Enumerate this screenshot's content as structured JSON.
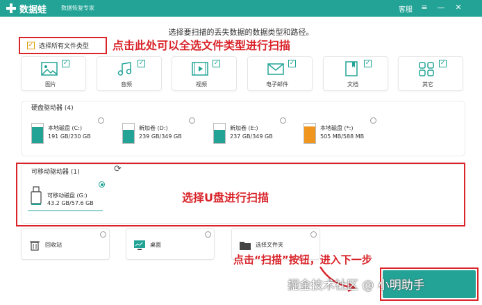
{
  "titlebar": {
    "app_name": "数据蛙",
    "app_subtitle": "数据恢复专家",
    "service": "客服",
    "menu_icon": "≡",
    "minimize_icon": "—",
    "close_icon": "✕"
  },
  "prompt": "选择要扫描的丢失数据的数据类型和路径。",
  "select_all": {
    "label": "选择所有文件类型",
    "checked": true
  },
  "annotations": {
    "select_all_hint": "点击此处可以全选文件类型进行扫描",
    "usb_hint": "选择U盘进行扫描",
    "scan_hint": "点击“扫描”按钮，进入下一步"
  },
  "file_types": [
    {
      "label": "图片",
      "icon": "image-icon",
      "checked": true
    },
    {
      "label": "音频",
      "icon": "music-icon",
      "checked": true
    },
    {
      "label": "视频",
      "icon": "video-icon",
      "checked": true
    },
    {
      "label": "电子邮件",
      "icon": "mail-icon",
      "checked": true
    },
    {
      "label": "文档",
      "icon": "document-icon",
      "checked": true
    },
    {
      "label": "其它",
      "icon": "other-icon",
      "checked": true
    }
  ],
  "hard_drives": {
    "title": "硬盘驱动器 (4)",
    "items": [
      {
        "name": "本地磁盘 (C:)",
        "size": "191 GB/230 GB",
        "usage": 0.83,
        "color": "#22a396"
      },
      {
        "name": "新加卷 (D:)",
        "size": "239 GB/349 GB",
        "usage": 0.68,
        "color": "#22a396"
      },
      {
        "name": "新加卷 (E:)",
        "size": "237 GB/349 GB",
        "usage": 0.68,
        "color": "#22a396"
      },
      {
        "name": "本地磁盘 (*:)",
        "size": "505 MB/588 MB",
        "usage": 0.86,
        "color": "#f0961e"
      }
    ]
  },
  "removable": {
    "title": "可移动驱动器 (1)",
    "items": [
      {
        "name": "可移动磁盘 (G:)",
        "size": "43.2 GB/57.6 GB",
        "selected": true
      }
    ]
  },
  "locations": [
    {
      "label": "回收站",
      "icon": "recycle-bin-icon"
    },
    {
      "label": "桌面",
      "icon": "desktop-icon"
    },
    {
      "label": "选择文件夹",
      "icon": "folder-icon"
    }
  ],
  "watermark": "掘金技术社区 @ 小明助手",
  "colors": {
    "accent": "#22a396",
    "annotation": "#d9242a",
    "checkbox": "#e0a000"
  }
}
